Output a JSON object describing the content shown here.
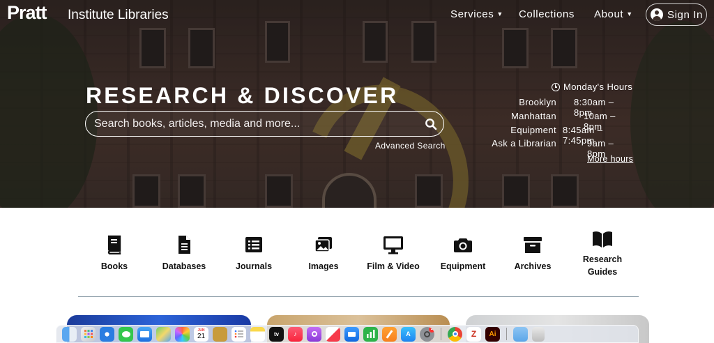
{
  "header": {
    "logo_pratt": "Pratt",
    "logo_sub": "Institute Libraries",
    "nav": [
      {
        "label": "Services",
        "has_caret": true
      },
      {
        "label": "Collections",
        "has_caret": false
      },
      {
        "label": "About",
        "has_caret": true
      }
    ],
    "sign_in": "Sign In"
  },
  "hero": {
    "headline": "RESEARCH & DISCOVER",
    "search_placeholder": "Search books, articles, media and more...",
    "advanced_search": "Advanced Search",
    "hours": {
      "title": "Monday's Hours",
      "rows": [
        {
          "location": "Brooklyn",
          "time": "8:30am – 8pm"
        },
        {
          "location": "Manhattan",
          "time": "10am – 8pm"
        },
        {
          "location": "Equipment",
          "time": "8:45am – 7:45pm"
        },
        {
          "location": "Ask a Librarian",
          "time": "9am – 8pm"
        }
      ],
      "more_link": "More hours"
    }
  },
  "categories": [
    {
      "label": "Books",
      "icon": "book-icon"
    },
    {
      "label": "Databases",
      "icon": "document-icon"
    },
    {
      "label": "Journals",
      "icon": "list-icon"
    },
    {
      "label": "Images",
      "icon": "images-icon"
    },
    {
      "label": "Film & Video",
      "icon": "monitor-icon"
    },
    {
      "label": "Equipment",
      "icon": "camera-icon"
    },
    {
      "label": "Archives",
      "icon": "archive-box-icon"
    },
    {
      "label": "Research Guides",
      "icon": "open-book-icon"
    }
  ],
  "dock": {
    "calendar_month": "JUN",
    "calendar_day": "21",
    "tv_label": "tv",
    "badge_count": "2",
    "apps": [
      "finder-icon",
      "launchpad-icon",
      "safari-icon",
      "messages-icon",
      "mail-icon",
      "maps-icon",
      "photos-icon",
      "calendar-icon",
      "notes-icon",
      "reminders-icon",
      "notes-yellow-icon",
      "appletv-icon",
      "music-icon",
      "podcasts-icon",
      "news-icon",
      "keynote-icon",
      "numbers-icon",
      "pages-icon",
      "appstore-icon",
      "settings-icon",
      "chrome-icon",
      "zotero-icon",
      "illustrator-icon",
      "folder-icon",
      "trash-icon"
    ]
  },
  "colors": {
    "divider": "#8fa0ab",
    "text_dark": "#111111",
    "hero_overlay": "#3b2d28"
  }
}
